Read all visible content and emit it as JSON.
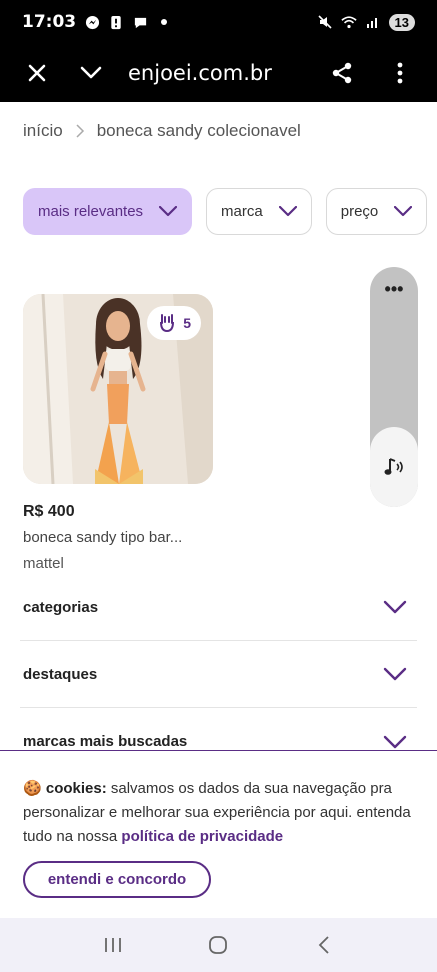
{
  "status_bar": {
    "time": "17:03",
    "battery": "13",
    "icons": [
      "messenger-icon",
      "lock-notification-icon",
      "chat-icon",
      "dot-icon",
      "mute-icon",
      "wifi-icon",
      "signal-icon"
    ]
  },
  "browser": {
    "url": "enjoei.com.br",
    "icons": [
      "close-icon",
      "chevron-down-icon",
      "share-icon",
      "more-vertical-icon"
    ]
  },
  "breadcrumb": {
    "home": "início",
    "current": "boneca sandy colecionavel"
  },
  "filters": [
    {
      "label": "mais relevantes",
      "active": true
    },
    {
      "label": "marca",
      "active": false
    },
    {
      "label": "preço",
      "active": false
    }
  ],
  "product": {
    "likes": "5",
    "price": "R$ 400",
    "title": "boneca sandy tipo bar...",
    "brand": "mattel"
  },
  "side_widget": {
    "menu": "•••",
    "icon": "music-note-icon"
  },
  "accordions": [
    {
      "label": "categorias"
    },
    {
      "label": "destaques"
    },
    {
      "label": "marcas mais buscadas"
    }
  ],
  "cookie": {
    "emoji": "🍪",
    "heading": "cookies:",
    "text": " salvamos os dados da sua navegação pra personalizar e melhorar sua experiência por aqui. entenda tudo na nossa ",
    "link": "política de privacidade",
    "button": "entendi e concordo"
  },
  "colors": {
    "accent": "#5a2d85",
    "chip_active": "#d9c6f8"
  }
}
